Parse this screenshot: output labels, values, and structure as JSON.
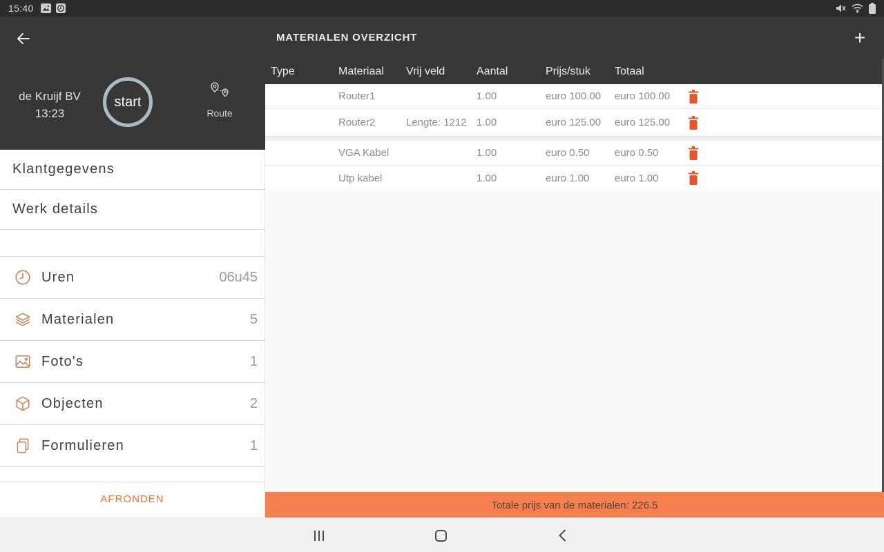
{
  "status_bar": {
    "time": "15:40"
  },
  "header": {
    "title": "MATERIALEN OVERZICHT",
    "add_label": "+"
  },
  "sidebar": {
    "company": "de Kruijf BV",
    "time": "13:23",
    "start_label": "start",
    "route_label": "Route",
    "nav_items": [
      {
        "label": "Klantgegevens"
      },
      {
        "label": "Werk details"
      }
    ],
    "count_items": [
      {
        "icon": "clock-icon",
        "label": "Uren",
        "value": "06u45"
      },
      {
        "icon": "layers-icon",
        "label": "Materialen",
        "value": "5"
      },
      {
        "icon": "photo-icon",
        "label": "Foto's",
        "value": "1"
      },
      {
        "icon": "cube-icon",
        "label": "Objecten",
        "value": "2"
      },
      {
        "icon": "document-icon",
        "label": "Formulieren",
        "value": "1"
      }
    ],
    "finish_label": "AFRONDEN"
  },
  "table": {
    "columns": [
      "Type",
      "Materiaal",
      "Vrij veld",
      "Aantal",
      "Prijs/stuk",
      "Totaal"
    ],
    "rows": [
      {
        "type": "",
        "materiaal": "Router1",
        "vrij_veld": "",
        "aantal": "1.00",
        "prijs": "euro 100.00",
        "totaal": "euro 100.00"
      },
      {
        "type": "",
        "materiaal": "Router2",
        "vrij_veld": "Lengte: 1212",
        "aantal": "1.00",
        "prijs": "euro 125.00",
        "totaal": "euro 125.00"
      },
      {
        "type": "",
        "materiaal": "VGA Kabel",
        "vrij_veld": "",
        "aantal": "1.00",
        "prijs": "euro 0.50",
        "totaal": "euro 0.50"
      },
      {
        "type": "",
        "materiaal": "Utp kabel",
        "vrij_veld": "",
        "aantal": "1.00",
        "prijs": "euro 1.00",
        "totaal": "euro 1.00"
      }
    ]
  },
  "footer": {
    "total_label": "Totale prijs van de materialen: 226.5"
  },
  "colors": {
    "dark_panel": "#373737",
    "accent_orange": "#e2572b",
    "total_bar_orange": "#f5804f",
    "icon_salmon": "#c9805c",
    "circle_border": "#a9bcc3"
  }
}
